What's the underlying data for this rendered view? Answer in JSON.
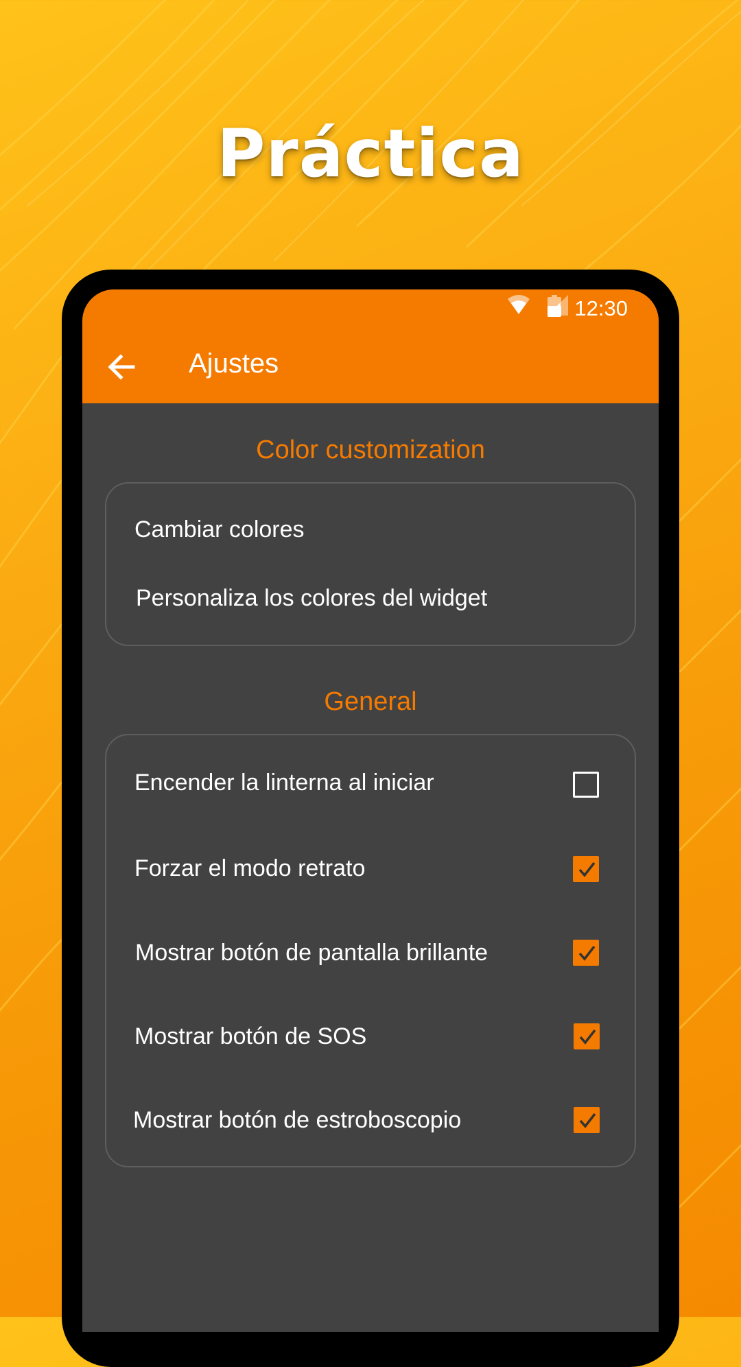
{
  "promo": {
    "title": "Práctica"
  },
  "status_bar": {
    "time": "12:30",
    "icons": [
      "wifi-icon",
      "cell-signal-icon",
      "battery-icon"
    ]
  },
  "app_bar": {
    "back_icon": "arrow-back-icon",
    "title": "Ajustes"
  },
  "sections": [
    {
      "header": "Color customization",
      "items": [
        {
          "label": "Cambiar colores"
        },
        {
          "label": "Personaliza los colores del widget"
        }
      ]
    },
    {
      "header": "General",
      "items": [
        {
          "label": "Encender la linterna al iniciar",
          "checked": false
        },
        {
          "label": "Forzar el modo retrato",
          "checked": true
        },
        {
          "label": "Mostrar botón de pantalla brillante",
          "checked": true
        },
        {
          "label": "Mostrar botón de SOS",
          "checked": true
        },
        {
          "label": "Mostrar botón de estroboscopio",
          "checked": true
        }
      ]
    }
  ],
  "colors": {
    "accent": "#f57b00",
    "background_dark": "#424242",
    "card_border": "#5e5e5e",
    "promo_bg_start": "#ffc21a",
    "promo_bg_end": "#f58a00",
    "text": "#ffffff",
    "check_mark": "#333333"
  }
}
